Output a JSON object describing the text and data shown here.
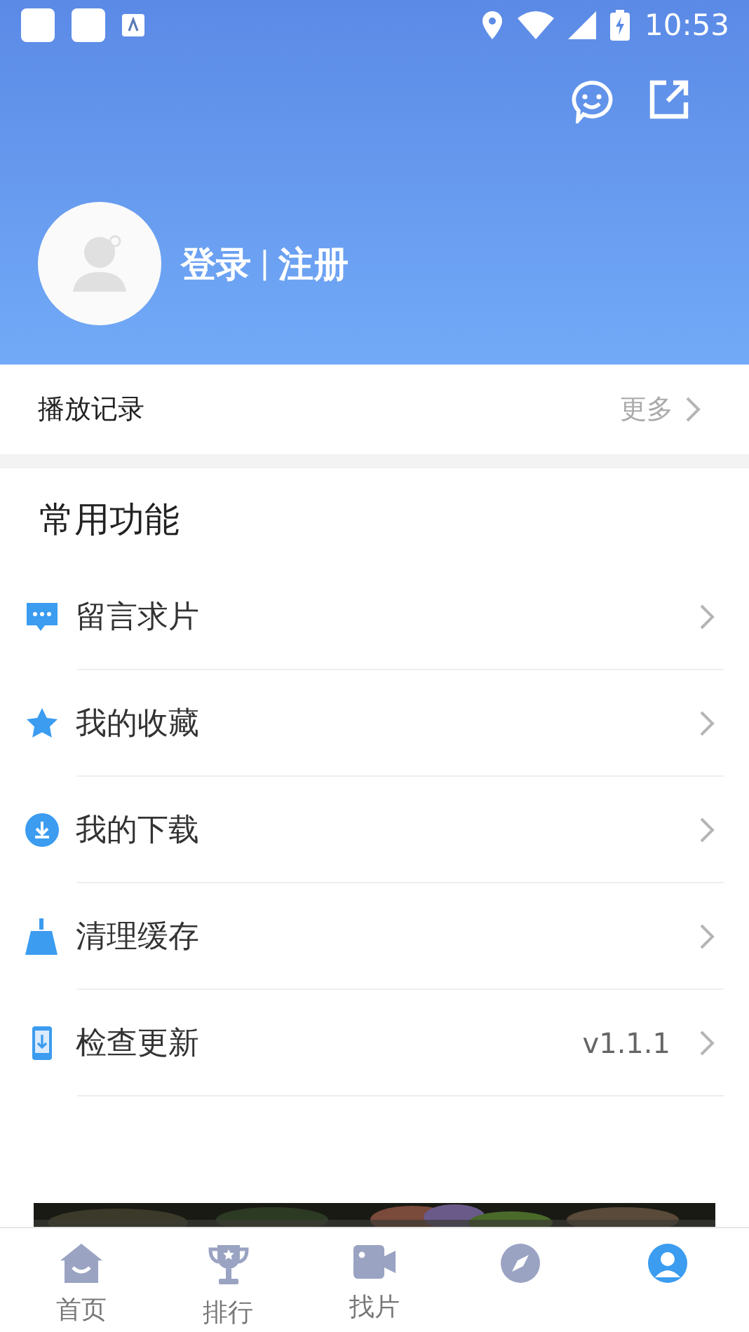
{
  "status_bar": {
    "time": "10:53"
  },
  "header": {
    "login": "登录",
    "separator": "|",
    "register": "注册"
  },
  "history": {
    "title": "播放记录",
    "more": "更多"
  },
  "section": {
    "title": "常用功能",
    "items": [
      {
        "kind": "message",
        "label": "留言求片"
      },
      {
        "kind": "star",
        "label": "我的收藏"
      },
      {
        "kind": "download",
        "label": "我的下载"
      },
      {
        "kind": "broom",
        "label": "清理缓存"
      },
      {
        "kind": "update",
        "label": "检查更新",
        "value": "v1.1.1"
      }
    ]
  },
  "nav": [
    {
      "kind": "home",
      "label": "首页",
      "selected": false
    },
    {
      "kind": "trophy",
      "label": "排行",
      "selected": false
    },
    {
      "kind": "video",
      "label": "找片",
      "selected": false
    },
    {
      "kind": "compass",
      "selected": false
    },
    {
      "kind": "profile",
      "selected": true
    }
  ]
}
